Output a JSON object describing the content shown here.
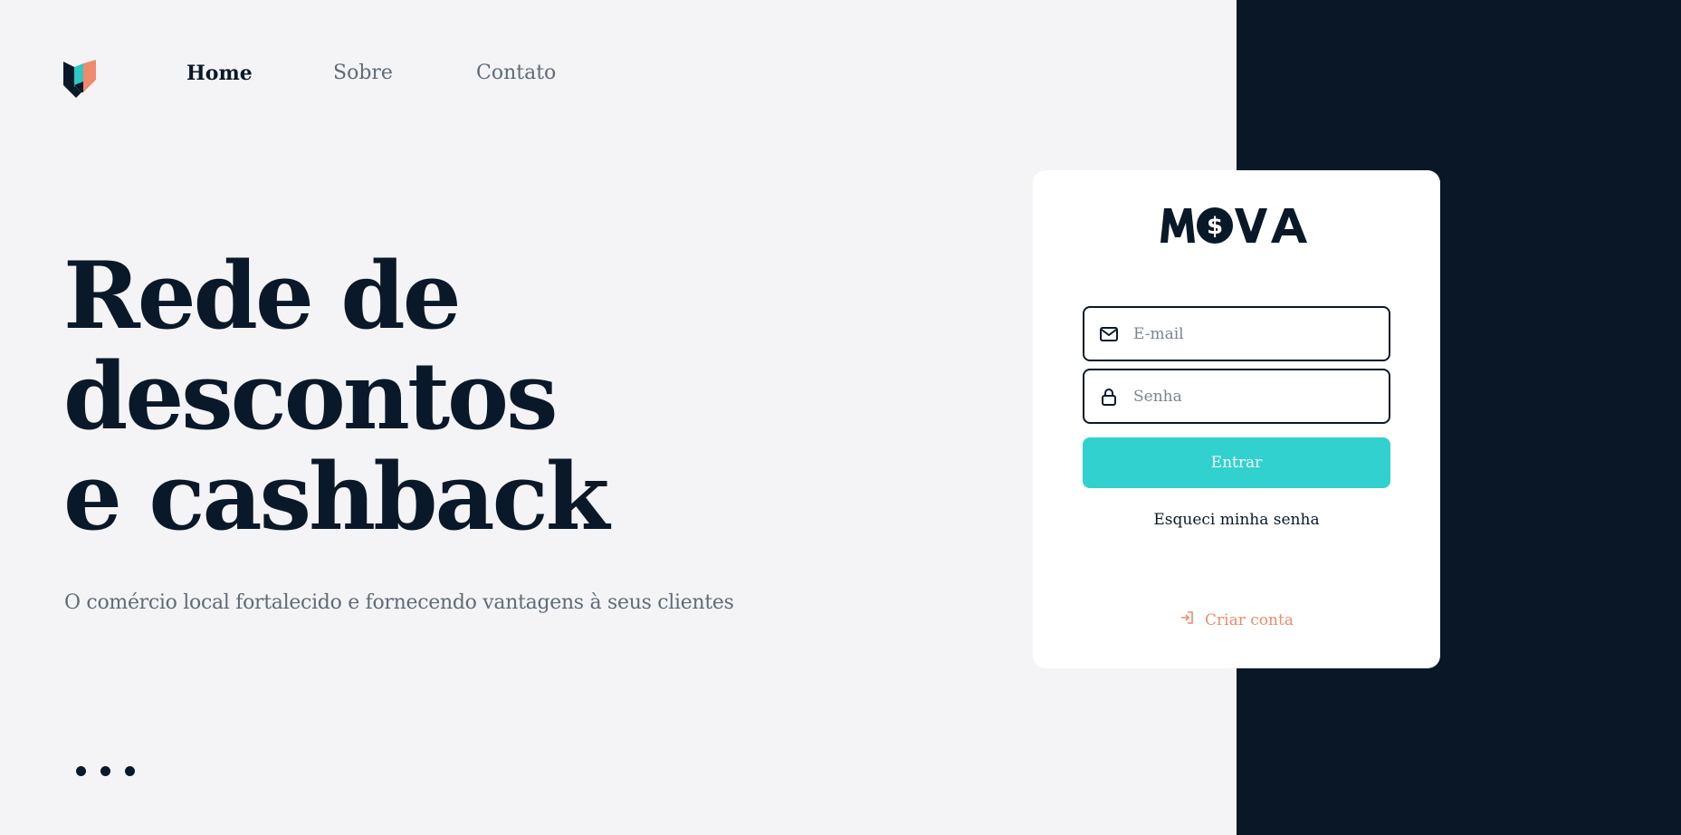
{
  "nav": {
    "items": [
      {
        "label": "Home",
        "active": true
      },
      {
        "label": "Sobre",
        "active": false
      },
      {
        "label": "Contato",
        "active": false
      }
    ]
  },
  "hero": {
    "title_lines": [
      "Rede de",
      "descontos",
      "e cashback"
    ],
    "subtitle": "O comércio local fortalecido e fornecendo vantagens à seus clientes"
  },
  "carousel": {
    "dots": 3
  },
  "login": {
    "brand": "MOVA",
    "email_placeholder": "E-mail",
    "password_placeholder": "Senha",
    "submit_label": "Entrar",
    "forgot_label": "Esqueci minha senha",
    "create_label": "Criar conta"
  },
  "icons": {
    "logo": "logo-shield-icon",
    "email": "envelope-icon",
    "password": "lock-icon",
    "create": "login-arrow-icon"
  },
  "colors": {
    "dark": "#0a1727",
    "accent": "#31d1cf",
    "coral": "#f08a6c",
    "background": "#f4f4f6"
  }
}
